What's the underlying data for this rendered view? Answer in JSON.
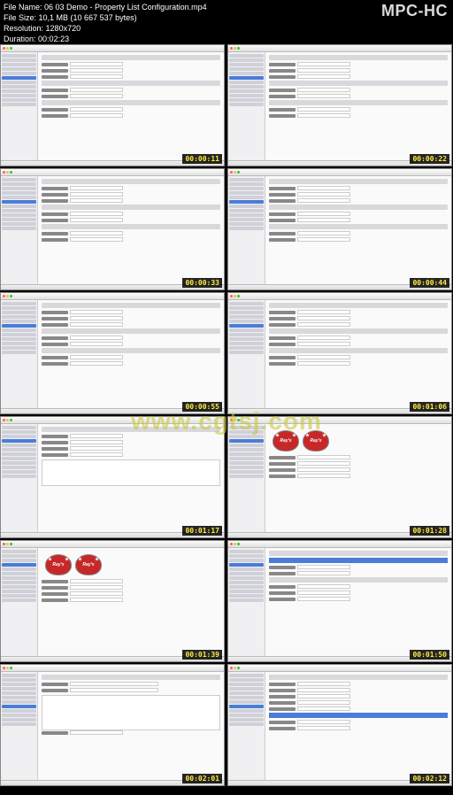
{
  "header": {
    "file_name_label": "File Name:",
    "file_name": "06 03 Demo - Property List Configuration.mp4",
    "file_size_label": "File Size:",
    "file_size": "10,1 MB (10 667 537 bytes)",
    "resolution_label": "Resolution:",
    "resolution": "1280x720",
    "duration_label": "Duration:",
    "duration": "00:02:23"
  },
  "app_title": "MPC-HC",
  "watermark": "www.cgtsj.com",
  "frames": [
    {
      "timestamp": "00:00:11",
      "variant": "form"
    },
    {
      "timestamp": "00:00:22",
      "variant": "form"
    },
    {
      "timestamp": "00:00:33",
      "variant": "form"
    },
    {
      "timestamp": "00:00:44",
      "variant": "form"
    },
    {
      "timestamp": "00:00:55",
      "variant": "form"
    },
    {
      "timestamp": "00:01:06",
      "variant": "form"
    },
    {
      "timestamp": "00:01:17",
      "variant": "panel"
    },
    {
      "timestamp": "00:01:28",
      "variant": "logo"
    },
    {
      "timestamp": "00:01:39",
      "variant": "logo"
    },
    {
      "timestamp": "00:01:50",
      "variant": "list"
    },
    {
      "timestamp": "00:02:01",
      "variant": "config"
    },
    {
      "timestamp": "00:02:12",
      "variant": "config"
    }
  ],
  "logo_text": "Ray's"
}
